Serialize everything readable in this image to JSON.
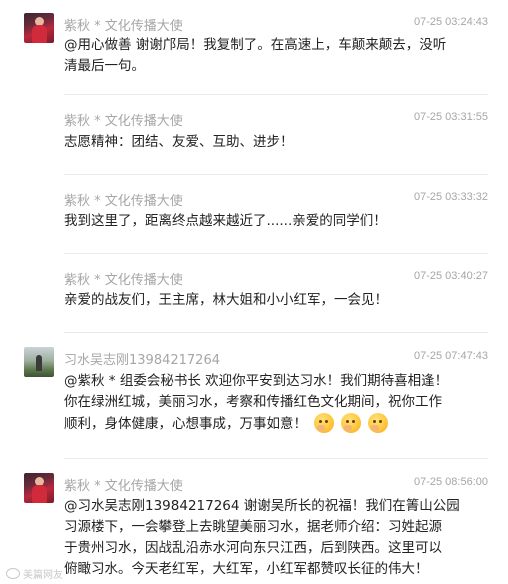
{
  "comments": [
    {
      "username": "紫秋 * 文化传播大使",
      "timestamp": "07-25 03:24:43",
      "avatar": "red-dress-avatar",
      "lines": [
        "@用心做善 谢谢邝局！我复制了。在高速上，车颠来颠去，没听",
        "清最后一句。"
      ]
    },
    {
      "username": "紫秋 * 文化传播大使",
      "timestamp": "07-25 03:31:55",
      "lines": [
        "志愿精神：团结、友爱、互助、进步！"
      ]
    },
    {
      "username": "紫秋 * 文化传播大使",
      "timestamp": "07-25 03:33:32",
      "lines": [
        "我到这里了，距离终点越来越近了......亲爱的同学们！"
      ]
    },
    {
      "username": "紫秋 * 文化传播大使",
      "timestamp": "07-25 03:40:27",
      "lines": [
        "亲爱的战友们，王主席，林大姐和小小红军，一会见！"
      ]
    },
    {
      "username": "习水吴志刚13984217264",
      "timestamp": "07-25 07:47:43",
      "avatar": "outdoor-photo-avatar",
      "lines": [
        "@紫秋 * 组委会秘书长 欢迎你平安到达习水！我们期待喜相逢！",
        "你在绿洲红城，美丽习水，考察和传播红色文化期间，祝你工作",
        "顺利，身体健康，心想事成，万事如意！"
      ],
      "emoji": [
        "laughing-face-emoji",
        "laughing-face-emoji",
        "laughing-face-emoji"
      ]
    },
    {
      "username": "紫秋 * 文化传播大使",
      "timestamp": "07-25 08:56:00",
      "avatar": "red-dress-avatar",
      "lines": [
        "@习水吴志刚13984217264 谢谢吴所长的祝福！我们在箐山公园",
        "习源楼下，一会攀登上去眺望美丽习水，据老师介绍：习姓起源",
        "于贵州习水，因战乱沿赤水河向东只江西，后到陕西。这里可以",
        "俯瞰习水。今天老红军，大红军，小红军都赞叹长征的伟大！"
      ]
    }
  ],
  "watermark": "美篇网友",
  "colors": {
    "meta_text": "#a6a6a6",
    "body_text": "#222222",
    "divider": "#e9e9e9"
  }
}
